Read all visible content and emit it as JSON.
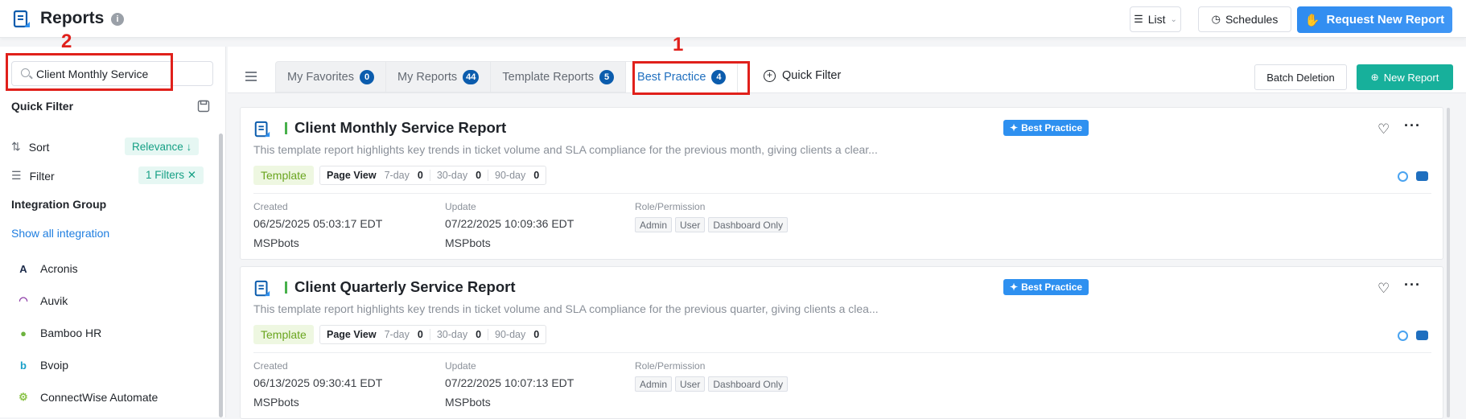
{
  "header": {
    "title": "Reports",
    "info_icon": "i",
    "list_label": "List",
    "schedules_label": "Schedules",
    "request_label": "Request New Report"
  },
  "annotations": {
    "marker_2": "2",
    "marker_1": "1"
  },
  "sidebar": {
    "search_value": "Client Monthly Service",
    "quick_filter_label": "Quick Filter",
    "sort_label": "Sort",
    "sort_value": "Relevance ↓",
    "filter_label": "Filter",
    "filter_value": "1 Filters ✕",
    "integration_group_label": "Integration Group",
    "show_all_label": "Show all integration",
    "integrations": [
      {
        "name": "Acronis",
        "glyph": "A",
        "color": "#1c2b4a"
      },
      {
        "name": "Auvik",
        "glyph": "◠",
        "color": "#8e3ea8"
      },
      {
        "name": "Bamboo HR",
        "glyph": "●",
        "color": "#6db33f"
      },
      {
        "name": "Bvoip",
        "glyph": "b",
        "color": "#1aa0c9"
      },
      {
        "name": "ConnectWise Automate",
        "glyph": "⚙",
        "color": "#8bc34a"
      }
    ]
  },
  "tabs": [
    {
      "label": "My Favorites",
      "count": "0"
    },
    {
      "label": "My Reports",
      "count": "44"
    },
    {
      "label": "Template Reports",
      "count": "5"
    },
    {
      "label": "Best Practice",
      "count": "4"
    }
  ],
  "toolbar": {
    "quick_filter_label": "Quick Filter",
    "batch_label": "Batch Deletion",
    "new_report_label": "New Report"
  },
  "cards": [
    {
      "title": "Client Monthly Service Report",
      "badge": "Best Practice",
      "description": "This template report highlights key trends in ticket volume and SLA compliance for the previous month, giving clients a clear...",
      "tag": "Template",
      "page_view_label": "Page View",
      "pv_7_label": "7-day",
      "pv_7": "0",
      "pv_30_label": "30-day",
      "pv_30": "0",
      "pv_90_label": "90-day",
      "pv_90": "0",
      "created_label": "Created",
      "created_date": "06/25/2025 05:03:17 EDT",
      "created_by": "MSPbots",
      "update_label": "Update",
      "update_date": "07/22/2025 10:09:36 EDT",
      "update_by": "MSPbots",
      "role_label": "Role/Permission",
      "roles": [
        "Admin",
        "User",
        "Dashboard Only"
      ]
    },
    {
      "title": "Client Quarterly Service Report",
      "badge": "Best Practice",
      "description": "This template report highlights key trends in ticket volume and SLA compliance for the previous quarter, giving clients a clea...",
      "tag": "Template",
      "page_view_label": "Page View",
      "pv_7_label": "7-day",
      "pv_7": "0",
      "pv_30_label": "30-day",
      "pv_30": "0",
      "pv_90_label": "90-day",
      "pv_90": "0",
      "created_label": "Created",
      "created_date": "06/13/2025 09:30:41 EDT",
      "created_by": "MSPbots",
      "update_label": "Update",
      "update_date": "07/22/2025 10:07:13 EDT",
      "update_by": "MSPbots",
      "role_label": "Role/Permission",
      "roles": [
        "Admin",
        "User",
        "Dashboard Only"
      ]
    }
  ]
}
